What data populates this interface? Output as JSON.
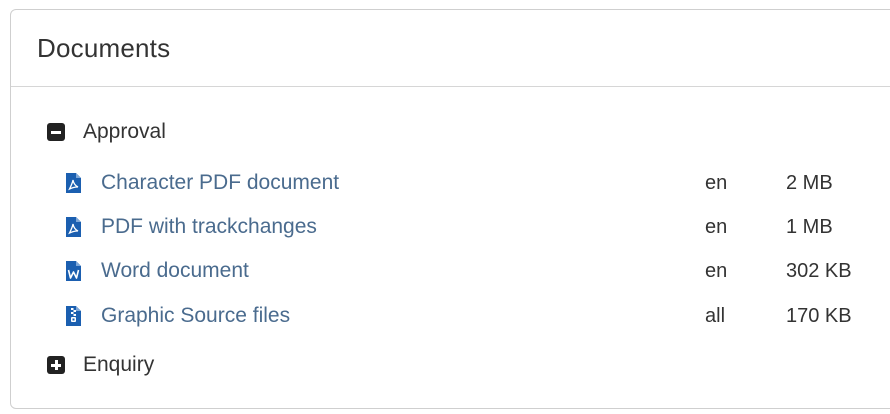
{
  "panel": {
    "title": "Documents"
  },
  "groups": [
    {
      "label": "Approval",
      "state": "expanded",
      "documents": [
        {
          "name": "Character PDF document",
          "lang": "en",
          "size": "2 MB",
          "icon": "pdf-file-icon"
        },
        {
          "name": "PDF with trackchanges",
          "lang": "en",
          "size": "1 MB",
          "icon": "pdf-file-icon"
        },
        {
          "name": "Word document",
          "lang": "en",
          "size": "302 KB",
          "icon": "word-file-icon"
        },
        {
          "name": "Graphic Source files",
          "lang": "all",
          "size": "170 KB",
          "icon": "zip-file-icon"
        }
      ]
    },
    {
      "label": "Enquiry",
      "state": "collapsed",
      "documents": []
    }
  ],
  "colors": {
    "link": "#4a6b8e",
    "icon": "#1b5fb0",
    "text": "#333333",
    "border": "#cfcfcf"
  }
}
